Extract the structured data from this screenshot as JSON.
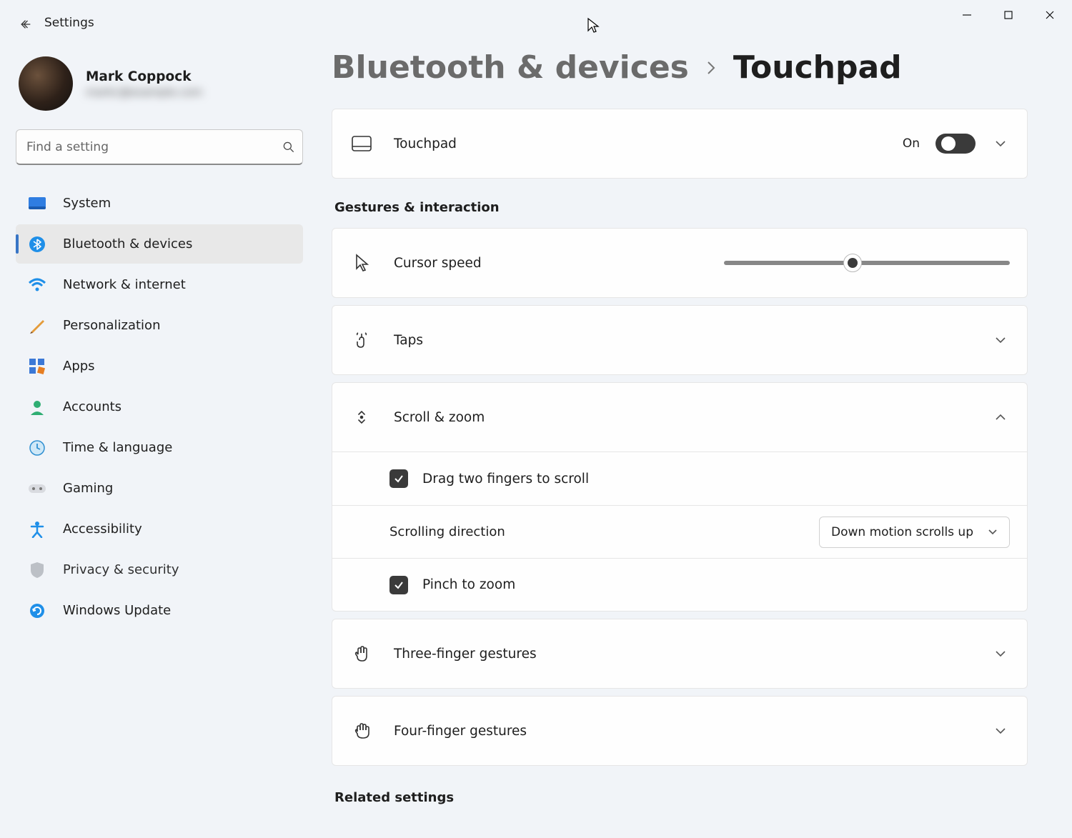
{
  "window": {
    "title": "Settings"
  },
  "user": {
    "name": "Mark Coppock",
    "email_masked": "markc@example.com"
  },
  "search": {
    "placeholder": "Find a setting"
  },
  "nav": {
    "items": [
      {
        "label": "System"
      },
      {
        "label": "Bluetooth & devices"
      },
      {
        "label": "Network & internet"
      },
      {
        "label": "Personalization"
      },
      {
        "label": "Apps"
      },
      {
        "label": "Accounts"
      },
      {
        "label": "Time & language"
      },
      {
        "label": "Gaming"
      },
      {
        "label": "Accessibility"
      },
      {
        "label": "Privacy & security"
      },
      {
        "label": "Windows Update"
      }
    ],
    "selected_index": 1
  },
  "breadcrumb": {
    "parent": "Bluetooth & devices",
    "current": "Touchpad"
  },
  "touchpad_card": {
    "label": "Touchpad",
    "state_text": "On",
    "on": true
  },
  "sections": {
    "gestures_title": "Gestures & interaction",
    "cursor_speed": {
      "label": "Cursor speed",
      "value_percent": 45
    },
    "taps": {
      "label": "Taps"
    },
    "scroll_zoom": {
      "label": "Scroll & zoom",
      "drag_two_fingers": {
        "label": "Drag two fingers to scroll",
        "checked": true
      },
      "scrolling_direction": {
        "label": "Scrolling direction",
        "value": "Down motion scrolls up"
      },
      "pinch_zoom": {
        "label": "Pinch to zoom",
        "checked": true
      }
    },
    "three_finger": {
      "label": "Three-finger gestures"
    },
    "four_finger": {
      "label": "Four-finger gestures"
    }
  },
  "related": {
    "title": "Related settings"
  }
}
